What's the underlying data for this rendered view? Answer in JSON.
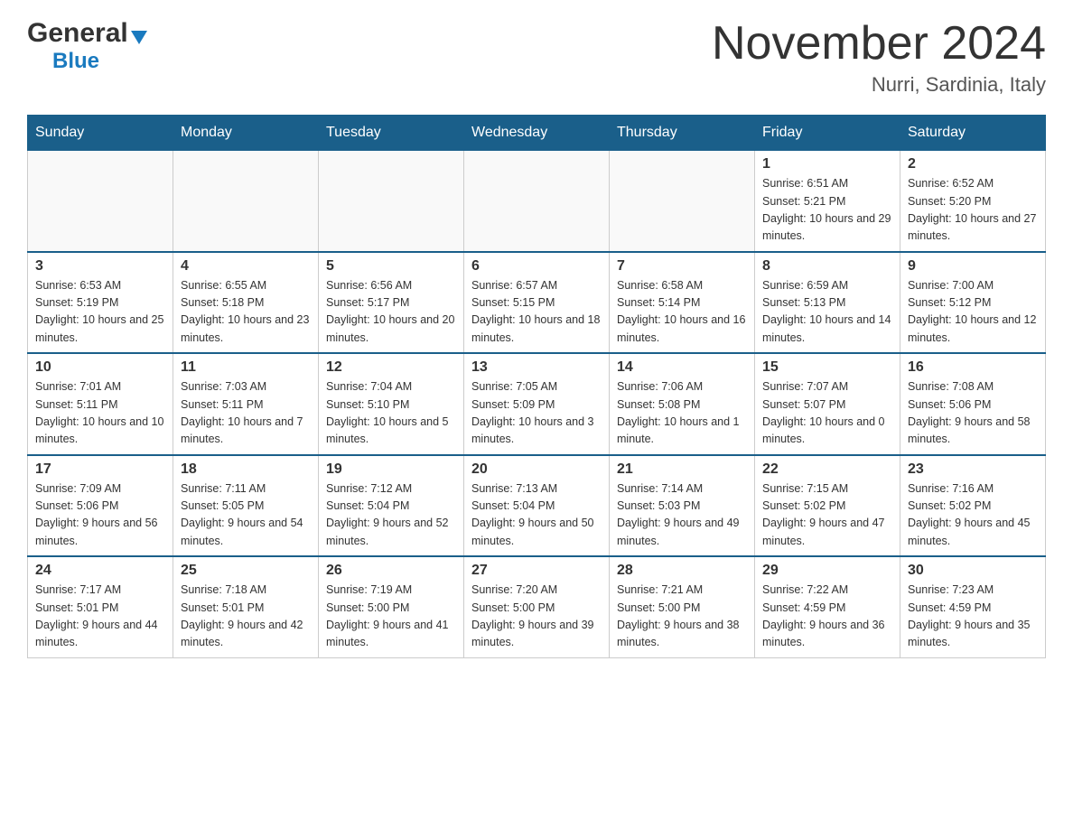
{
  "header": {
    "logo_general": "General",
    "logo_arrow": "▶",
    "logo_blue": "Blue",
    "title": "November 2024",
    "subtitle": "Nurri, Sardinia, Italy"
  },
  "days_of_week": [
    "Sunday",
    "Monday",
    "Tuesday",
    "Wednesday",
    "Thursday",
    "Friday",
    "Saturday"
  ],
  "weeks": [
    [
      {
        "day": "",
        "sunrise": "",
        "sunset": "",
        "daylight": ""
      },
      {
        "day": "",
        "sunrise": "",
        "sunset": "",
        "daylight": ""
      },
      {
        "day": "",
        "sunrise": "",
        "sunset": "",
        "daylight": ""
      },
      {
        "day": "",
        "sunrise": "",
        "sunset": "",
        "daylight": ""
      },
      {
        "day": "",
        "sunrise": "",
        "sunset": "",
        "daylight": ""
      },
      {
        "day": "1",
        "sunrise": "Sunrise: 6:51 AM",
        "sunset": "Sunset: 5:21 PM",
        "daylight": "Daylight: 10 hours and 29 minutes."
      },
      {
        "day": "2",
        "sunrise": "Sunrise: 6:52 AM",
        "sunset": "Sunset: 5:20 PM",
        "daylight": "Daylight: 10 hours and 27 minutes."
      }
    ],
    [
      {
        "day": "3",
        "sunrise": "Sunrise: 6:53 AM",
        "sunset": "Sunset: 5:19 PM",
        "daylight": "Daylight: 10 hours and 25 minutes."
      },
      {
        "day": "4",
        "sunrise": "Sunrise: 6:55 AM",
        "sunset": "Sunset: 5:18 PM",
        "daylight": "Daylight: 10 hours and 23 minutes."
      },
      {
        "day": "5",
        "sunrise": "Sunrise: 6:56 AM",
        "sunset": "Sunset: 5:17 PM",
        "daylight": "Daylight: 10 hours and 20 minutes."
      },
      {
        "day": "6",
        "sunrise": "Sunrise: 6:57 AM",
        "sunset": "Sunset: 5:15 PM",
        "daylight": "Daylight: 10 hours and 18 minutes."
      },
      {
        "day": "7",
        "sunrise": "Sunrise: 6:58 AM",
        "sunset": "Sunset: 5:14 PM",
        "daylight": "Daylight: 10 hours and 16 minutes."
      },
      {
        "day": "8",
        "sunrise": "Sunrise: 6:59 AM",
        "sunset": "Sunset: 5:13 PM",
        "daylight": "Daylight: 10 hours and 14 minutes."
      },
      {
        "day": "9",
        "sunrise": "Sunrise: 7:00 AM",
        "sunset": "Sunset: 5:12 PM",
        "daylight": "Daylight: 10 hours and 12 minutes."
      }
    ],
    [
      {
        "day": "10",
        "sunrise": "Sunrise: 7:01 AM",
        "sunset": "Sunset: 5:11 PM",
        "daylight": "Daylight: 10 hours and 10 minutes."
      },
      {
        "day": "11",
        "sunrise": "Sunrise: 7:03 AM",
        "sunset": "Sunset: 5:11 PM",
        "daylight": "Daylight: 10 hours and 7 minutes."
      },
      {
        "day": "12",
        "sunrise": "Sunrise: 7:04 AM",
        "sunset": "Sunset: 5:10 PM",
        "daylight": "Daylight: 10 hours and 5 minutes."
      },
      {
        "day": "13",
        "sunrise": "Sunrise: 7:05 AM",
        "sunset": "Sunset: 5:09 PM",
        "daylight": "Daylight: 10 hours and 3 minutes."
      },
      {
        "day": "14",
        "sunrise": "Sunrise: 7:06 AM",
        "sunset": "Sunset: 5:08 PM",
        "daylight": "Daylight: 10 hours and 1 minute."
      },
      {
        "day": "15",
        "sunrise": "Sunrise: 7:07 AM",
        "sunset": "Sunset: 5:07 PM",
        "daylight": "Daylight: 10 hours and 0 minutes."
      },
      {
        "day": "16",
        "sunrise": "Sunrise: 7:08 AM",
        "sunset": "Sunset: 5:06 PM",
        "daylight": "Daylight: 9 hours and 58 minutes."
      }
    ],
    [
      {
        "day": "17",
        "sunrise": "Sunrise: 7:09 AM",
        "sunset": "Sunset: 5:06 PM",
        "daylight": "Daylight: 9 hours and 56 minutes."
      },
      {
        "day": "18",
        "sunrise": "Sunrise: 7:11 AM",
        "sunset": "Sunset: 5:05 PM",
        "daylight": "Daylight: 9 hours and 54 minutes."
      },
      {
        "day": "19",
        "sunrise": "Sunrise: 7:12 AM",
        "sunset": "Sunset: 5:04 PM",
        "daylight": "Daylight: 9 hours and 52 minutes."
      },
      {
        "day": "20",
        "sunrise": "Sunrise: 7:13 AM",
        "sunset": "Sunset: 5:04 PM",
        "daylight": "Daylight: 9 hours and 50 minutes."
      },
      {
        "day": "21",
        "sunrise": "Sunrise: 7:14 AM",
        "sunset": "Sunset: 5:03 PM",
        "daylight": "Daylight: 9 hours and 49 minutes."
      },
      {
        "day": "22",
        "sunrise": "Sunrise: 7:15 AM",
        "sunset": "Sunset: 5:02 PM",
        "daylight": "Daylight: 9 hours and 47 minutes."
      },
      {
        "day": "23",
        "sunrise": "Sunrise: 7:16 AM",
        "sunset": "Sunset: 5:02 PM",
        "daylight": "Daylight: 9 hours and 45 minutes."
      }
    ],
    [
      {
        "day": "24",
        "sunrise": "Sunrise: 7:17 AM",
        "sunset": "Sunset: 5:01 PM",
        "daylight": "Daylight: 9 hours and 44 minutes."
      },
      {
        "day": "25",
        "sunrise": "Sunrise: 7:18 AM",
        "sunset": "Sunset: 5:01 PM",
        "daylight": "Daylight: 9 hours and 42 minutes."
      },
      {
        "day": "26",
        "sunrise": "Sunrise: 7:19 AM",
        "sunset": "Sunset: 5:00 PM",
        "daylight": "Daylight: 9 hours and 41 minutes."
      },
      {
        "day": "27",
        "sunrise": "Sunrise: 7:20 AM",
        "sunset": "Sunset: 5:00 PM",
        "daylight": "Daylight: 9 hours and 39 minutes."
      },
      {
        "day": "28",
        "sunrise": "Sunrise: 7:21 AM",
        "sunset": "Sunset: 5:00 PM",
        "daylight": "Daylight: 9 hours and 38 minutes."
      },
      {
        "day": "29",
        "sunrise": "Sunrise: 7:22 AM",
        "sunset": "Sunset: 4:59 PM",
        "daylight": "Daylight: 9 hours and 36 minutes."
      },
      {
        "day": "30",
        "sunrise": "Sunrise: 7:23 AM",
        "sunset": "Sunset: 4:59 PM",
        "daylight": "Daylight: 9 hours and 35 minutes."
      }
    ]
  ]
}
